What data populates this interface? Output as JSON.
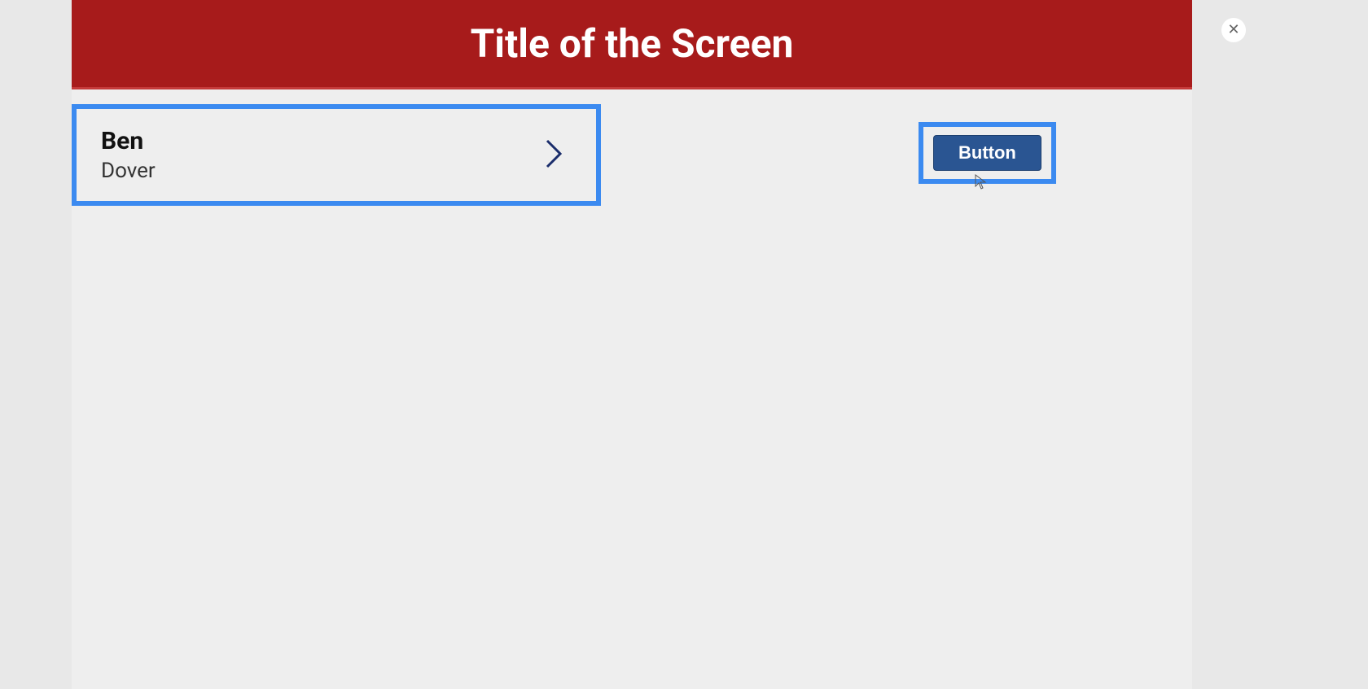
{
  "header": {
    "title": "Title of the Screen"
  },
  "list": {
    "items": [
      {
        "title": "Ben",
        "subtitle": "Dover"
      }
    ]
  },
  "actions": {
    "primary_label": "Button"
  },
  "close_label": "✕"
}
